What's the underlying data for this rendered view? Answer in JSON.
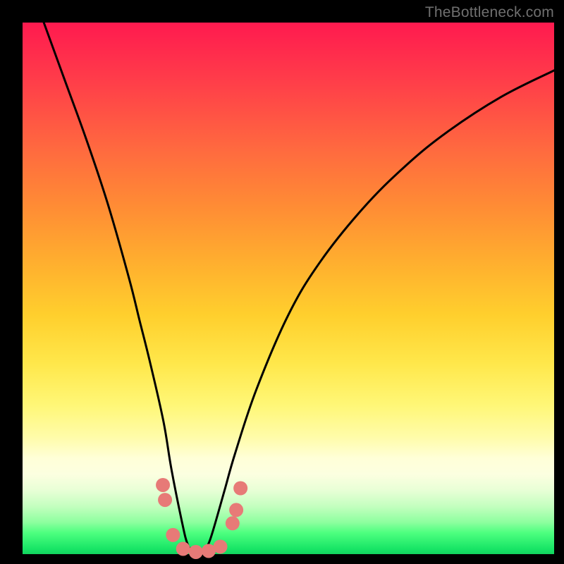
{
  "watermark": "TheBottleneck.com",
  "chart_data": {
    "type": "line",
    "title": "",
    "xlabel": "",
    "ylabel": "",
    "xlim": [
      0,
      100
    ],
    "ylim": [
      0,
      100
    ],
    "grid": false,
    "series": [
      {
        "name": "bottleneck-curve",
        "x": [
          4,
          8,
          12,
          16,
          20,
          22,
          24,
          26.5,
          28,
          30,
          31,
          32,
          33,
          34,
          35,
          36,
          38,
          40,
          44,
          50,
          56,
          64,
          72,
          80,
          90,
          100
        ],
        "y": [
          100,
          89,
          78,
          66,
          52,
          44,
          36,
          25,
          16,
          6,
          2,
          0.5,
          0,
          0.5,
          2,
          5,
          12,
          19,
          31,
          45,
          55,
          65,
          73,
          79.5,
          86,
          91
        ]
      }
    ],
    "markers": {
      "name": "highlighted-points",
      "color": "#e77a77",
      "points": [
        {
          "x": 26.4,
          "y": 13.0
        },
        {
          "x": 26.8,
          "y": 10.2
        },
        {
          "x": 28.3,
          "y": 3.6
        },
        {
          "x": 30.2,
          "y": 1.0
        },
        {
          "x": 32.6,
          "y": 0.4
        },
        {
          "x": 35.0,
          "y": 0.6
        },
        {
          "x": 37.2,
          "y": 1.4
        },
        {
          "x": 39.5,
          "y": 5.8
        },
        {
          "x": 40.2,
          "y": 8.3
        },
        {
          "x": 41.0,
          "y": 12.4
        }
      ]
    }
  }
}
